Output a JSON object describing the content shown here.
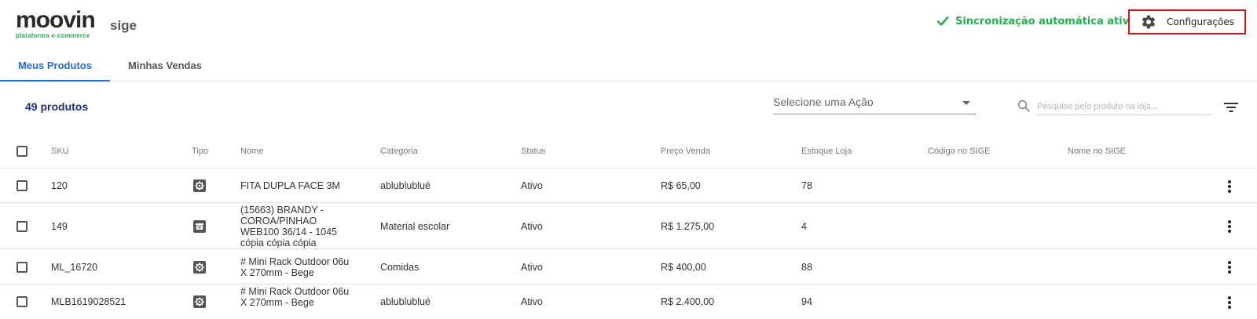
{
  "brand": {
    "logo_word": "moovin",
    "logo_sub": "plataforma e-commerce",
    "app_name": "sige"
  },
  "status": {
    "sync_text": "Sincronização automática ativa",
    "sync_color": "#22b14c"
  },
  "header": {
    "config_label": "Configurações",
    "config_icon": "gear-icon"
  },
  "tabs": [
    {
      "label": "Meus Produtos",
      "active": true
    },
    {
      "label": "Minhas Vendas",
      "active": false
    }
  ],
  "toolbar": {
    "count_label": "49 produtos",
    "action_select": "Selecione uma Ação",
    "search_placeholder": "Pesquise pelo produto na loja...",
    "search_value": ""
  },
  "table": {
    "columns": [
      "SKU",
      "Tipo",
      "Nome",
      "Categoria",
      "Status",
      "Preço Venda",
      "Estoque Loja",
      "Código no SIGE",
      "Nome no SIGE"
    ],
    "rows": [
      {
        "sku": "120",
        "type": "gear-icon",
        "name": "FITA DUPLA FACE 3M",
        "category": "ablublublué",
        "status": "Ativo",
        "price": "R$ 65,00",
        "stock": "78",
        "sige_code": "",
        "sige_name": ""
      },
      {
        "sku": "149",
        "type": "archive-icon",
        "name": "(15663) BRANDY - COROA/PINHAO WEB100 36/14 - 1045 cópia cópia cópia",
        "category": "Material escolar",
        "status": "Ativo",
        "price": "R$ 1.275,00",
        "stock": "4",
        "sige_code": "",
        "sige_name": ""
      },
      {
        "sku": "ML_16720",
        "type": "gear-icon",
        "name": "# Mini Rack Outdoor 06u X 270mm - Bege",
        "category": "Comidas",
        "status": "Ativo",
        "price": "R$ 400,00",
        "stock": "88",
        "sige_code": "",
        "sige_name": ""
      },
      {
        "sku": "MLB1619028521",
        "type": "gear-icon",
        "name": "# Mini Rack Outdoor 06u X 270mm - Bege",
        "category": "ablublublué",
        "status": "Ativo",
        "price": "R$ 2.400,00",
        "stock": "94",
        "sige_code": "",
        "sige_name": ""
      }
    ]
  },
  "colors": {
    "accent": "#1b6ee0",
    "highlight_border": "#e0121a",
    "count_text": "#1f2d7a"
  }
}
